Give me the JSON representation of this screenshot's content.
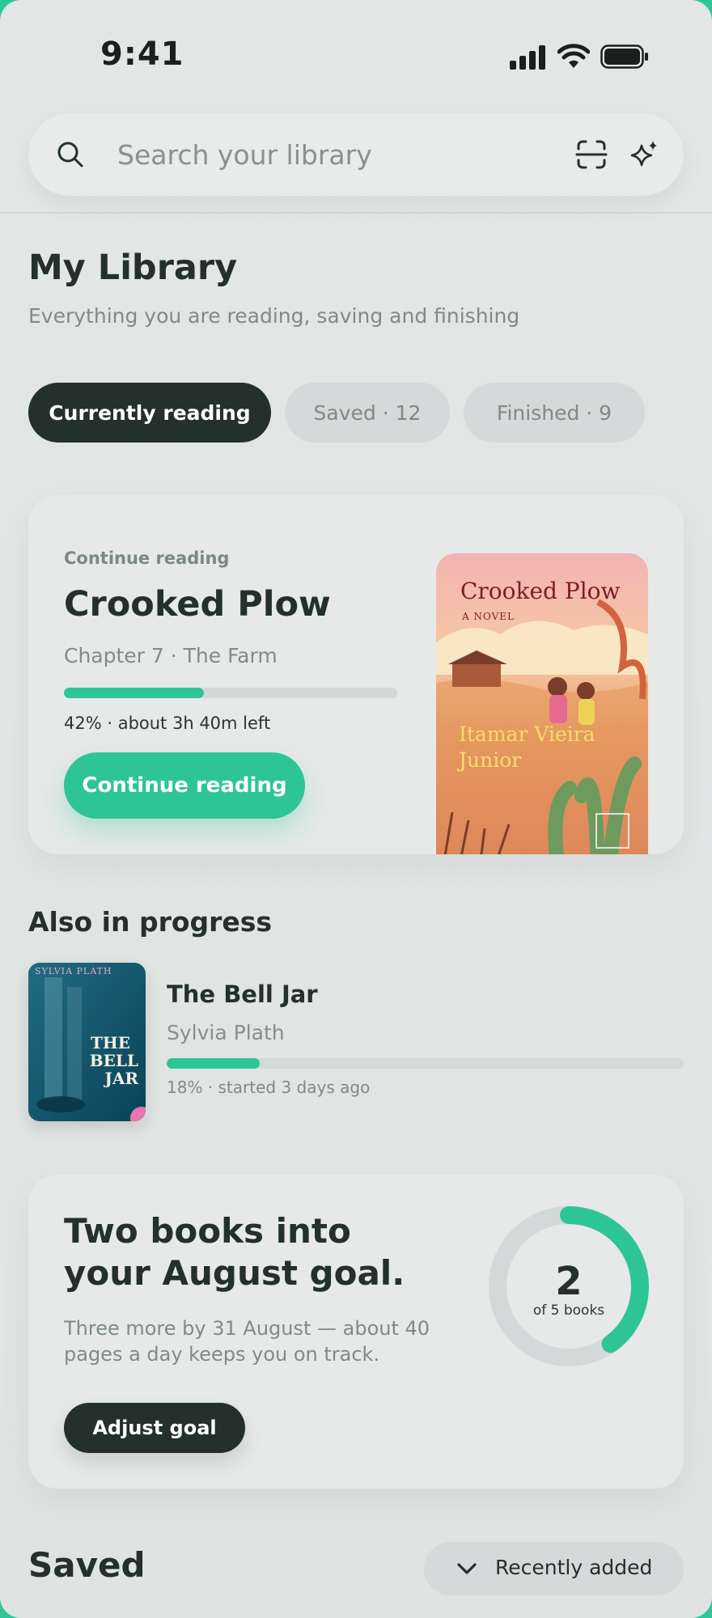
{
  "status_bar": {
    "time": "9:41",
    "icons": [
      "cellular-signal-icon",
      "wifi-icon",
      "battery-icon"
    ]
  },
  "search": {
    "placeholder": "Search your library",
    "value": "",
    "icons": [
      "search-icon",
      "scan-icon",
      "sparkle-icon"
    ]
  },
  "header": {
    "title": "My Library",
    "subtitle": "Everything you are reading, saving and finishing"
  },
  "tabs": [
    {
      "label": "Currently reading",
      "active": true
    },
    {
      "label": "Saved · 12",
      "active": false
    },
    {
      "label": "Finished · 9",
      "active": false
    }
  ],
  "continue_card": {
    "eyebrow": "Continue reading",
    "title": "Crooked Plow",
    "chapter": "Chapter 7 · The Farm",
    "progress": 0.42,
    "meta": "42% · about 3h 40m left",
    "button": "Continue reading",
    "cover": {
      "title": "Crooked Plow",
      "subtitle": "A NOVEL",
      "author_line1": "Itamar Vieira",
      "author_line2": "Junior"
    }
  },
  "in_progress": {
    "heading": "Also in progress",
    "items": [
      {
        "title": "The Bell Jar",
        "author": "Sylvia Plath",
        "progress": 0.18,
        "meta": "18% · started 3 days ago",
        "cover": {
          "author": "SYLVIA PLATH",
          "title_line1": "THE",
          "title_line2": "BELL",
          "title_line3": "JAR"
        }
      }
    ]
  },
  "goal": {
    "title": "Two books into your August goal.",
    "description": "Three more by 31 August — about 40 pages a day keeps you on track.",
    "button": "Adjust goal",
    "count": "2",
    "caption": "of 5 books",
    "completed": 2,
    "target": 5
  },
  "saved": {
    "heading": "Saved",
    "sort_label": "Recently added",
    "sort_icon": "chevron-down-icon"
  },
  "colors": {
    "accent": "#2ec596",
    "dark": "#24302c",
    "background": "#e2e6e5",
    "pill_inactive": "#d4dad9"
  }
}
